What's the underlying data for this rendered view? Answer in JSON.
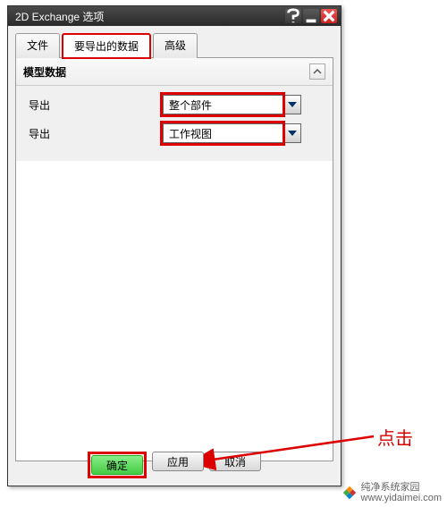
{
  "window": {
    "title": "2D Exchange 选项"
  },
  "tabs": [
    {
      "label": "文件",
      "active": false
    },
    {
      "label": "要导出的数据",
      "active": true,
      "highlighted": true
    },
    {
      "label": "高级",
      "active": false
    }
  ],
  "section": {
    "title": "模型数据",
    "rows": [
      {
        "label": "导出",
        "value": "整个部件"
      },
      {
        "label": "导出",
        "value": "工作视图"
      }
    ]
  },
  "buttons": {
    "ok": "确定",
    "apply": "应用",
    "cancel": "取消"
  },
  "annotation": {
    "click_label": "点击"
  },
  "watermark": {
    "line1": "纯净系统家园",
    "line2": "www.yidaimei.com"
  }
}
